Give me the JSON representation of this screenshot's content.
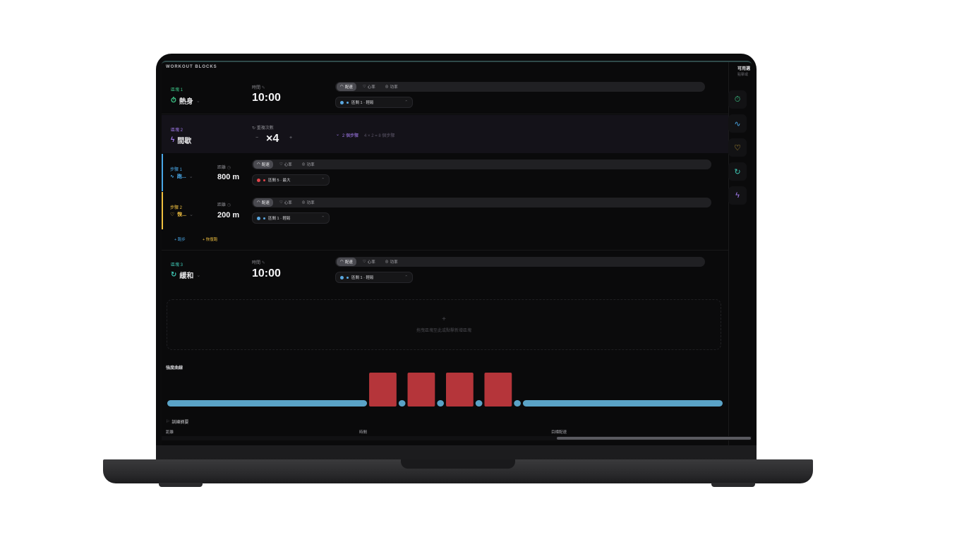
{
  "app": {
    "section_title": "WORKOUT BLOCKS",
    "right_panel_title": "可用選",
    "right_panel_subtitle": "點擊或"
  },
  "colors": {
    "warmup": "#3ec98a",
    "interval": "#a47cf0",
    "run": "#4aa8e8",
    "recovery": "#f0c040",
    "cooldown": "#3ec9b6",
    "zone_easy": "#5aa8e0",
    "zone_max": "#e0444a"
  },
  "blocks": [
    {
      "label": "區塊 1",
      "name": "熱身",
      "icon": "stopwatch-icon",
      "field_label": "時間",
      "value": "10:00",
      "tabs": [
        "配速",
        "心率",
        "功率"
      ],
      "active_tab": "配速",
      "zone": "區間 1 · 輕鬆"
    },
    {
      "label": "區塊 2",
      "name": "間歇",
      "icon": "lightning-icon",
      "field_label": "重複次數",
      "value": "×4",
      "minus": "−",
      "plus": "+",
      "steps_toggle": "2 個步驟",
      "steps_hint": "4 × 2 = 8 個步驟"
    },
    {
      "label": "區塊 3",
      "name": "緩和",
      "icon": "refresh-icon",
      "field_label": "時間",
      "value": "10:00",
      "tabs": [
        "配速",
        "心率",
        "功率"
      ],
      "active_tab": "配速",
      "zone": "區間 1 · 輕鬆"
    }
  ],
  "steps": [
    {
      "label": "步驟 1",
      "name": "跑...",
      "icon": "pulse-icon",
      "field_label": "距離",
      "value": "800 m",
      "tabs": [
        "配速",
        "心率",
        "功率"
      ],
      "active_tab": "配速",
      "zone": "區間 5 · 最大"
    },
    {
      "label": "步驟 2",
      "name": "恢...",
      "icon": "heart-icon",
      "field_label": "距離",
      "value": "200 m",
      "tabs": [
        "配速",
        "心率",
        "功率"
      ],
      "active_tab": "配速",
      "zone": "區間 1 · 輕鬆"
    }
  ],
  "add_buttons": {
    "run": "+ 跑步",
    "recovery": "+ 恢復跑"
  },
  "dropzone": {
    "plus": "+",
    "text": "拖曳區塊至此或點擊新增區塊"
  },
  "chart": {
    "title": "強度曲線"
  },
  "chart_data": {
    "type": "bar",
    "series": [
      {
        "segments": [
          {
            "kind": "warmup",
            "zone": 1,
            "duration_min": 10
          },
          {
            "kind": "run",
            "zone": 5,
            "distance_m": 800
          },
          {
            "kind": "recovery",
            "zone": 1,
            "distance_m": 200
          },
          {
            "kind": "run",
            "zone": 5,
            "distance_m": 800
          },
          {
            "kind": "recovery",
            "zone": 1,
            "distance_m": 200
          },
          {
            "kind": "run",
            "zone": 5,
            "distance_m": 800
          },
          {
            "kind": "recovery",
            "zone": 1,
            "distance_m": 200
          },
          {
            "kind": "run",
            "zone": 5,
            "distance_m": 800
          },
          {
            "kind": "recovery",
            "zone": 1,
            "distance_m": 200
          },
          {
            "kind": "cooldown",
            "zone": 1,
            "duration_min": 10
          }
        ]
      }
    ]
  },
  "summary": {
    "title": "訓練摘要",
    "columns": [
      "距離",
      "時間",
      "目標配速"
    ]
  },
  "rail": [
    "stopwatch-icon",
    "pulse-icon",
    "heart-icon",
    "refresh-icon",
    "lightning-icon"
  ]
}
